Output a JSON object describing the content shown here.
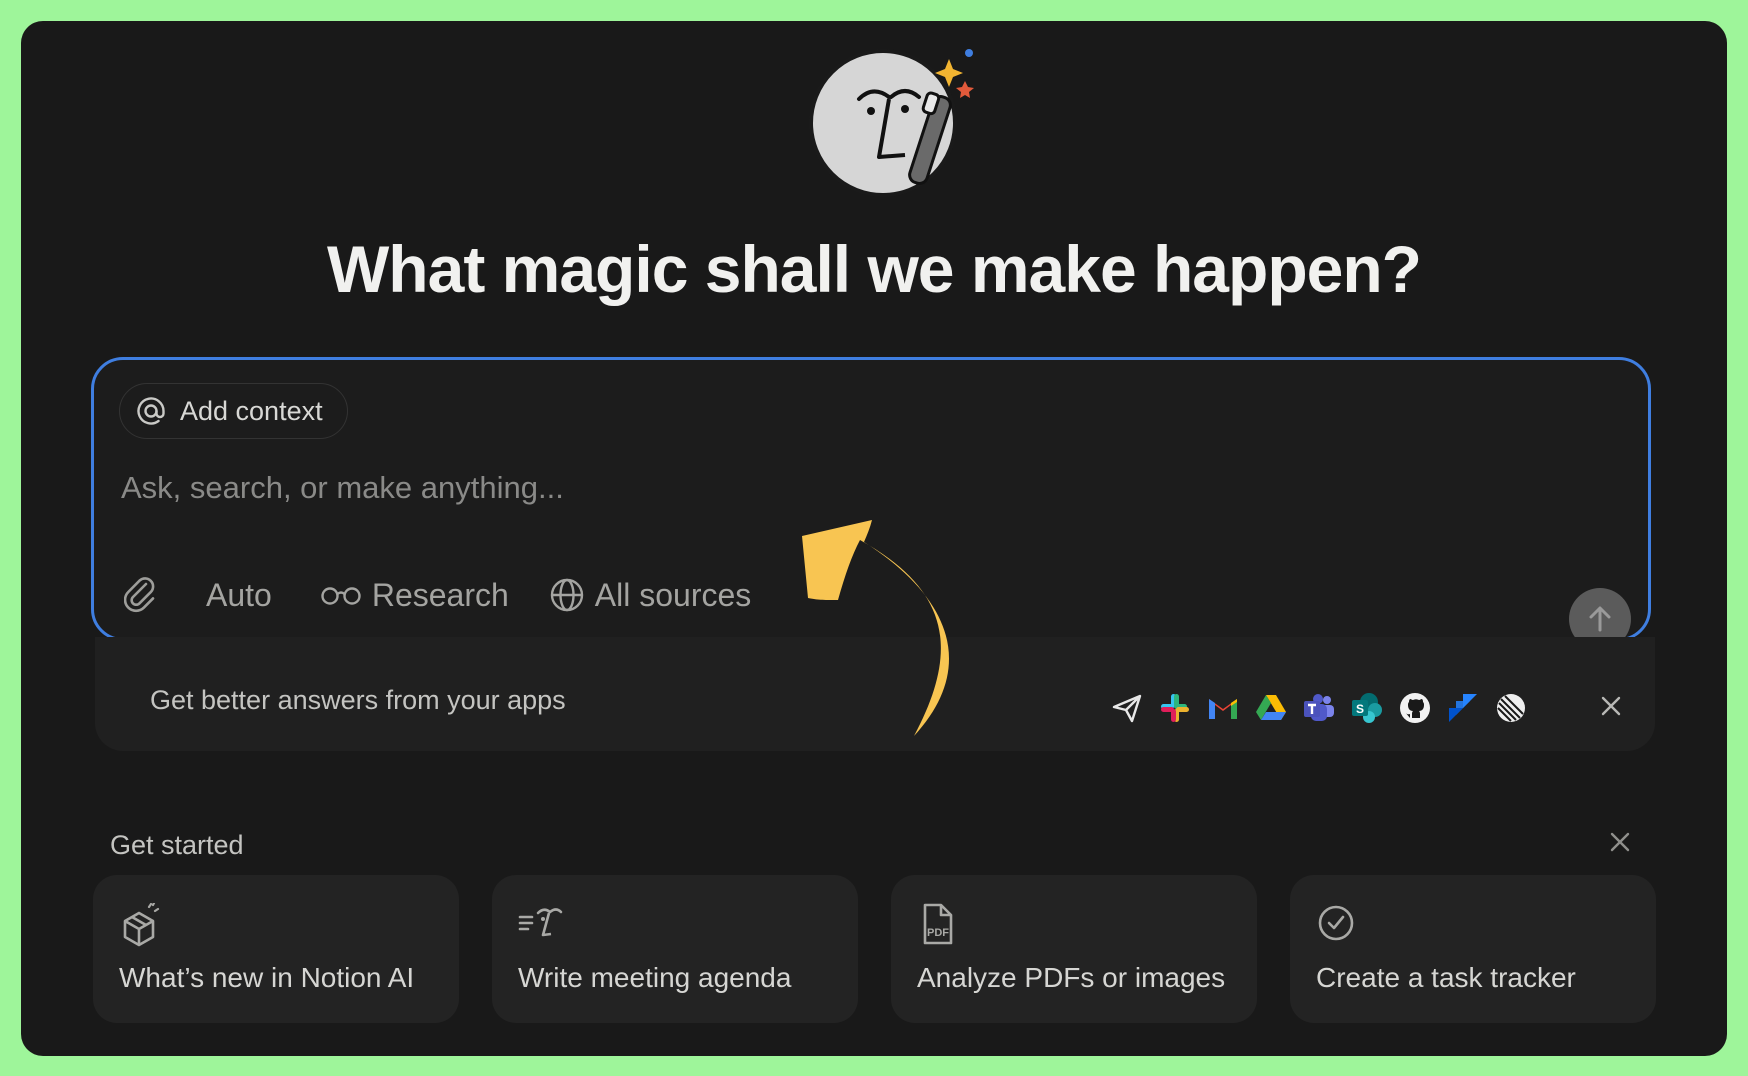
{
  "headline": "What magic shall we make happen?",
  "composer": {
    "add_context_label": "Add context",
    "placeholder": "Ask, search, or make anything...",
    "tools": {
      "auto_label": "Auto",
      "research_label": "Research",
      "sources_label": "All sources"
    },
    "send_icon": "arrow-up-icon"
  },
  "apps_banner": {
    "text": "Get better answers from your apps",
    "apps": [
      "mail-send-icon",
      "slack-icon",
      "gmail-icon",
      "google-drive-icon",
      "teams-icon",
      "sharepoint-icon",
      "github-icon",
      "jira-icon",
      "linear-icon"
    ]
  },
  "get_started": {
    "title": "Get started",
    "cards": [
      {
        "label": "What’s new in Notion AI",
        "icon": "gift-box-icon"
      },
      {
        "label": "Write meeting agenda",
        "icon": "agenda-icon"
      },
      {
        "label": "Analyze PDFs or images",
        "icon": "pdf-icon"
      },
      {
        "label": "Create a task tracker",
        "icon": "check-circle-icon"
      }
    ]
  },
  "colors": {
    "background": "#9ef59a",
    "window": "#191919",
    "accent_border": "#3f7ee0",
    "arrow": "#f8c552"
  }
}
